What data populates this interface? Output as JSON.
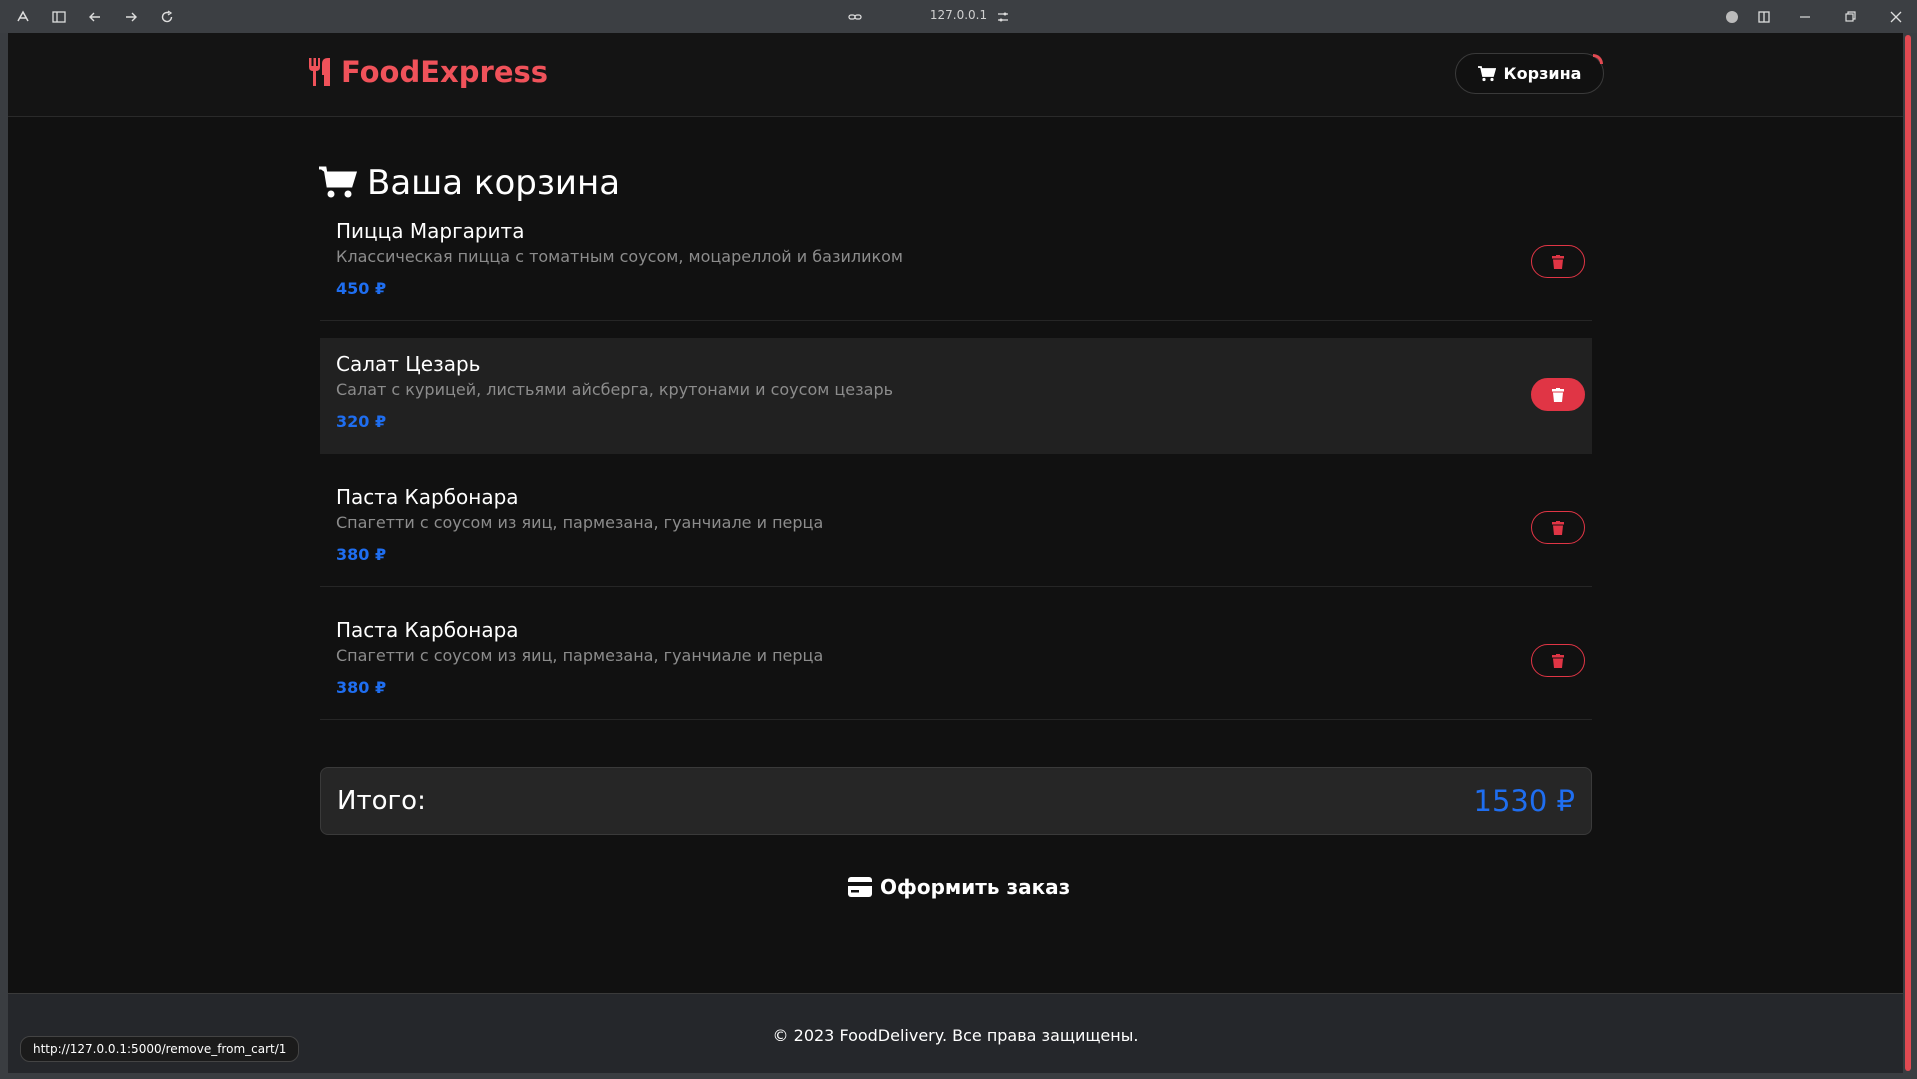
{
  "browser": {
    "url": "127.0.0.1",
    "status_url": "http://127.0.0.1:5000/remove_from_cart/1"
  },
  "header": {
    "logo_text": "FoodExpress",
    "cart_label": "Корзина"
  },
  "page": {
    "title": "Ваша корзина"
  },
  "cart": {
    "items": [
      {
        "name": "Пицца Маргарита",
        "description": "Классическая пицца с томатным соусом, моцареллой и базиликом",
        "price": "450 ₽"
      },
      {
        "name": "Салат Цезарь",
        "description": "Салат с курицей, листьями айсберга, крутонами и соусом цезарь",
        "price": "320 ₽"
      },
      {
        "name": "Паста Карбонара",
        "description": "Спагетти с соусом из яиц, пармезана, гуанчиале и перца",
        "price": "380 ₽"
      },
      {
        "name": "Паста Карбонара",
        "description": "Спагетти с соусом из яиц, пармезана, гуанчиале и перца",
        "price": "380 ₽"
      }
    ],
    "total_label": "Итого:",
    "total_value": "1530 ₽",
    "checkout_label": "Оформить заказ"
  },
  "footer": {
    "copyright": "© 2023 FoodDelivery. Все права защищены."
  },
  "colors": {
    "accent": "#f0525a",
    "price": "#1f6ef0",
    "delete": "#e03545",
    "background": "#111111"
  }
}
